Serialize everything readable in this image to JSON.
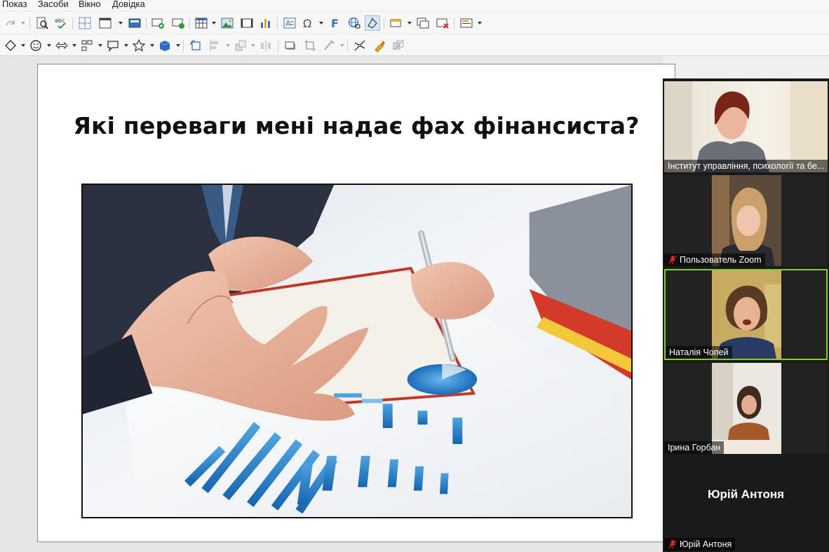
{
  "menu": {
    "items": [
      "Показ",
      "Засоби",
      "Вікно",
      "Довідка"
    ]
  },
  "toolbar_icons_row1": [
    "redo-icon",
    "find-replace-icon",
    "spellcheck-icon",
    "grid-icon",
    "display-views-icon",
    "master-slide-icon",
    "new-slide-icon",
    "duplicate-slide-icon",
    "table-icon",
    "image-icon",
    "media-icon",
    "chart-icon",
    "textbox-icon",
    "special-character-icon",
    "fontwork-icon",
    "hyperlink-icon",
    "shape-icon",
    "show-draw-icon",
    "copy-slide-icon",
    "delete-slide-icon",
    "slide-layout-icon"
  ],
  "toolbar_icons_row2": [
    "basic-shapes-icon",
    "smiley-icon",
    "arrows-icon",
    "flowchart-icon",
    "callout-icon",
    "star-icon",
    "3d-object-icon",
    "rotate-icon",
    "align-icon",
    "arrange-icon",
    "distribute-icon",
    "shadow-icon",
    "crop-icon",
    "filter-icon",
    "points-icon",
    "glue-points-icon",
    "toggle-extrusion-icon"
  ],
  "slide": {
    "title": "Які переваги мені надає фах фінансиста?"
  },
  "participants": [
    {
      "name": "Інститут управління, психології та бе...",
      "muted": false,
      "speaking": false
    },
    {
      "name": "Пользователь Zoom",
      "muted": true,
      "speaking": false
    },
    {
      "name": "Наталія Чопей",
      "muted": false,
      "speaking": true
    },
    {
      "name": "Ірина Горбан",
      "muted": false,
      "speaking": false
    },
    {
      "name": "Юрій Антоня",
      "muted": true,
      "speaking": false,
      "video_off_label": "Юрій Антоня"
    }
  ],
  "colors": {
    "active_speaker_border": "#7ed321",
    "gallery_background": "#1a1a1a",
    "muted_icon": "#e02828"
  }
}
